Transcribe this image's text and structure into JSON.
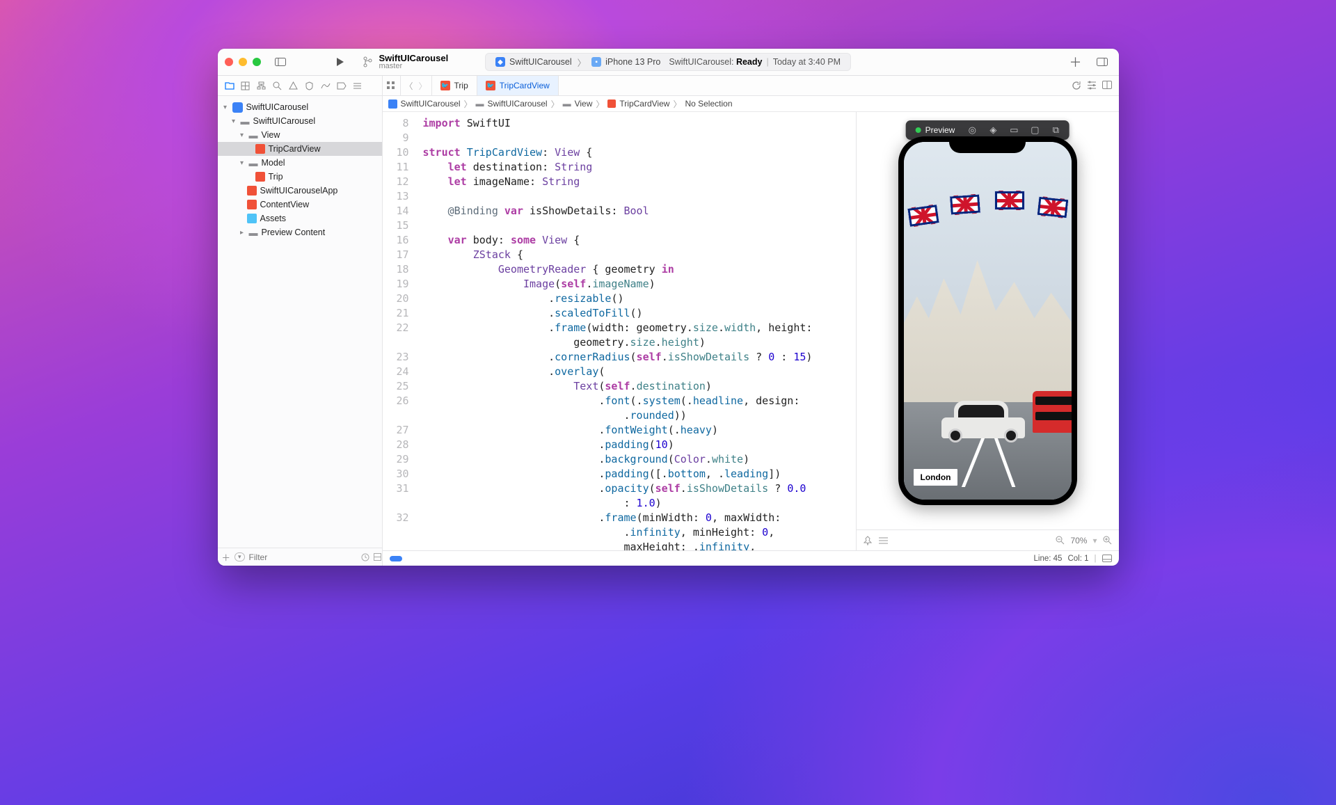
{
  "titlebar": {
    "project": "SwiftUICarousel",
    "branch": "master",
    "scheme": "SwiftUICarousel",
    "device": "iPhone 13 Pro",
    "status_prefix": "SwiftUICarousel: ",
    "status_word": "Ready",
    "status_time": "Today at 3:40 PM"
  },
  "tabs": {
    "t1": "Trip",
    "t2": "TripCardView"
  },
  "jumpbar": {
    "p1": "SwiftUICarousel",
    "p2": "SwiftUICarousel",
    "p3": "View",
    "p4": "TripCardView",
    "p5": "No Selection"
  },
  "navigator": {
    "root": "SwiftUICarousel",
    "grp1": "SwiftUICarousel",
    "grpView": "View",
    "fileTripCard": "TripCardView",
    "grpModel": "Model",
    "fileTrip": "Trip",
    "fileApp": "SwiftUICarouselApp",
    "fileContent": "ContentView",
    "fileAssets": "Assets",
    "grpPreview": "Preview Content",
    "filterPlaceholder": "Filter"
  },
  "gutter": [
    "8",
    "9",
    "10",
    "11",
    "12",
    "13",
    "14",
    "15",
    "16",
    "17",
    "18",
    "19",
    "20",
    "21",
    "22",
    "",
    "23",
    "24",
    "25",
    "26",
    "",
    "27",
    "28",
    "29",
    "30",
    "31",
    "",
    "32",
    "",
    ""
  ],
  "preview": {
    "btn": "Preview",
    "label": "London",
    "zoom": "70%"
  },
  "status": {
    "line": "Line: 45",
    "col": "Col: 1"
  }
}
